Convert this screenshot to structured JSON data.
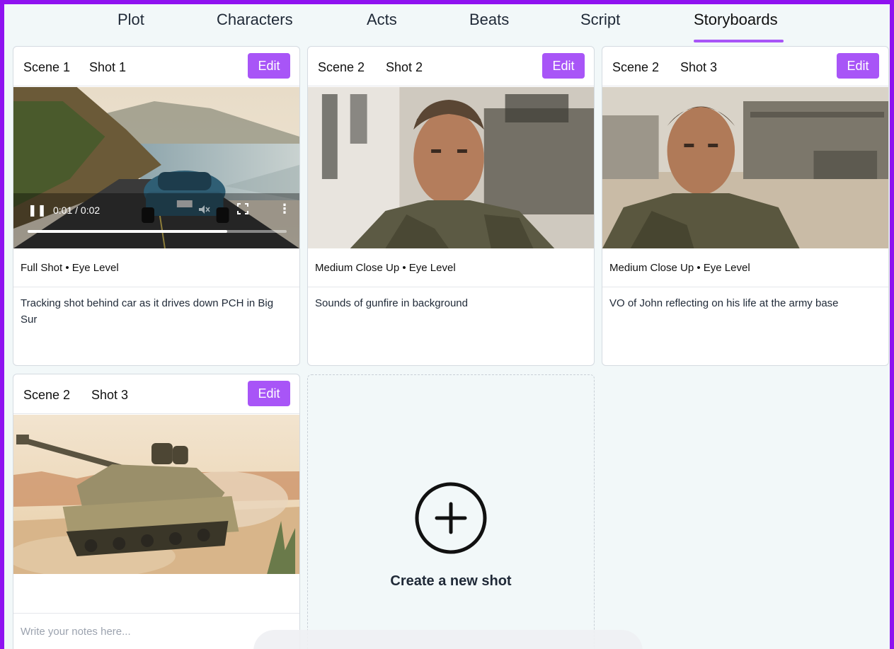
{
  "tabs": [
    {
      "label": "Plot"
    },
    {
      "label": "Characters"
    },
    {
      "label": "Acts"
    },
    {
      "label": "Beats"
    },
    {
      "label": "Script"
    },
    {
      "label": "Storyboards"
    }
  ],
  "active_tab": "Storyboards",
  "accent_color": "#a855f7",
  "frame_color": "#8f12f0",
  "cards": [
    {
      "scene": "Scene 1",
      "shot": "Shot 1",
      "edit_label": "Edit",
      "media": "video",
      "video_time": "0:01 / 0:02",
      "video_progress": 0.77,
      "shot_type": "Full Shot • Eye Level",
      "description": "Tracking shot behind car as it drives down PCH in Big Sur"
    },
    {
      "scene": "Scene 2",
      "shot": "Shot 2",
      "edit_label": "Edit",
      "media": "image",
      "shot_type": "Medium Close Up • Eye Level",
      "description": "Sounds of gunfire in background"
    },
    {
      "scene": "Scene 2",
      "shot": "Shot 3",
      "edit_label": "Edit",
      "media": "image",
      "shot_type": "Medium Close Up • Eye Level",
      "description": "VO of John reflecting on his life at the army base"
    },
    {
      "scene": "Scene 2",
      "shot": "Shot 3",
      "edit_label": "Edit",
      "media": "image",
      "notes_placeholder": "Write your notes here..."
    }
  ],
  "create_shot": {
    "label": "Create a new shot",
    "icon": "plus-circle-icon"
  },
  "video_icons": [
    "pause-icon",
    "mute-icon",
    "fullscreen-icon",
    "more-vertical-icon"
  ]
}
